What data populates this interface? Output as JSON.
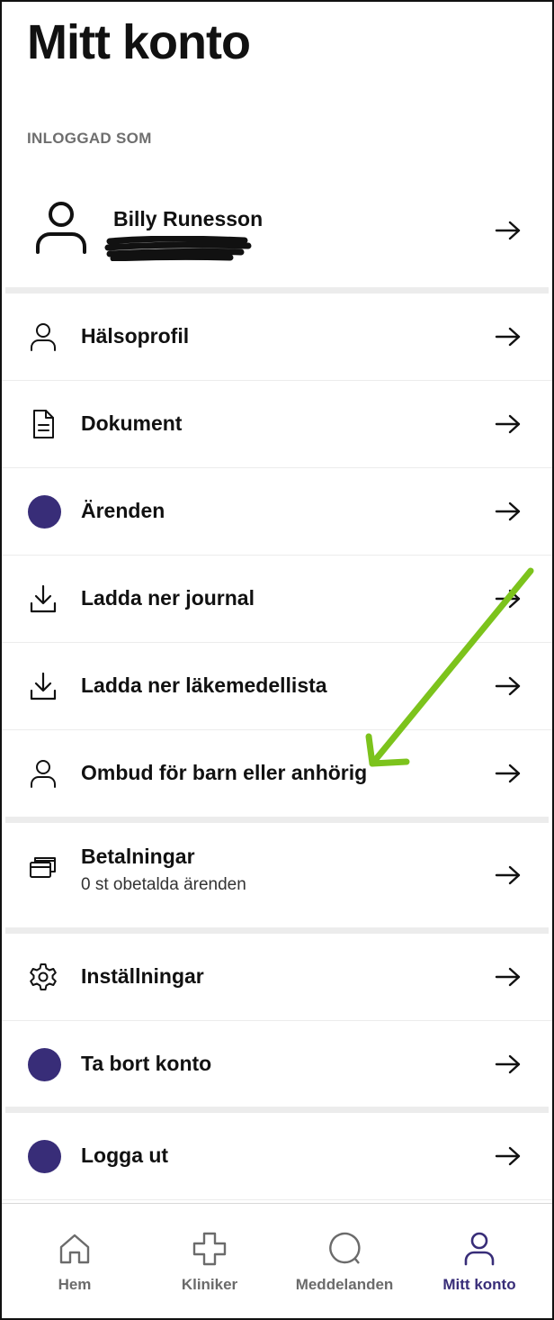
{
  "header": {
    "title": "Mitt konto"
  },
  "account": {
    "section_label": "INLOGGAD SOM",
    "user_name": "Billy Runesson"
  },
  "menu": {
    "items": [
      {
        "label": "Hälsoprofil",
        "icon": "person-icon"
      },
      {
        "label": "Dokument",
        "icon": "document-icon"
      },
      {
        "label": "Ärenden",
        "icon": "placeholder-dot-icon"
      },
      {
        "label": "Ladda ner journal",
        "icon": "download-icon"
      },
      {
        "label": "Ladda ner läkemedellista",
        "icon": "download-icon"
      },
      {
        "label": "Ombud för barn eller anhörig",
        "icon": "person-icon"
      }
    ],
    "payments": {
      "label": "Betalningar",
      "sublabel": "0 st obetalda ärenden",
      "icon": "cards-icon"
    },
    "settings": {
      "label": "Inställningar",
      "icon": "gear-icon"
    },
    "delete": {
      "label": "Ta bort konto",
      "icon": "placeholder-dot-icon"
    },
    "logout": {
      "label": "Logga ut",
      "icon": "placeholder-dot-icon"
    }
  },
  "tabbar": {
    "tabs": [
      {
        "label": "Hem",
        "icon": "home-icon",
        "active": false
      },
      {
        "label": "Kliniker",
        "icon": "cross-icon",
        "active": false
      },
      {
        "label": "Meddelanden",
        "icon": "chat-bubble-icon",
        "active": false
      },
      {
        "label": "Mitt konto",
        "icon": "person-icon",
        "active": true
      }
    ]
  },
  "colors": {
    "accent": "#382d78",
    "annotation_arrow": "#7cc31c",
    "separator": "#ececec",
    "muted_text": "#6e6e6e"
  }
}
